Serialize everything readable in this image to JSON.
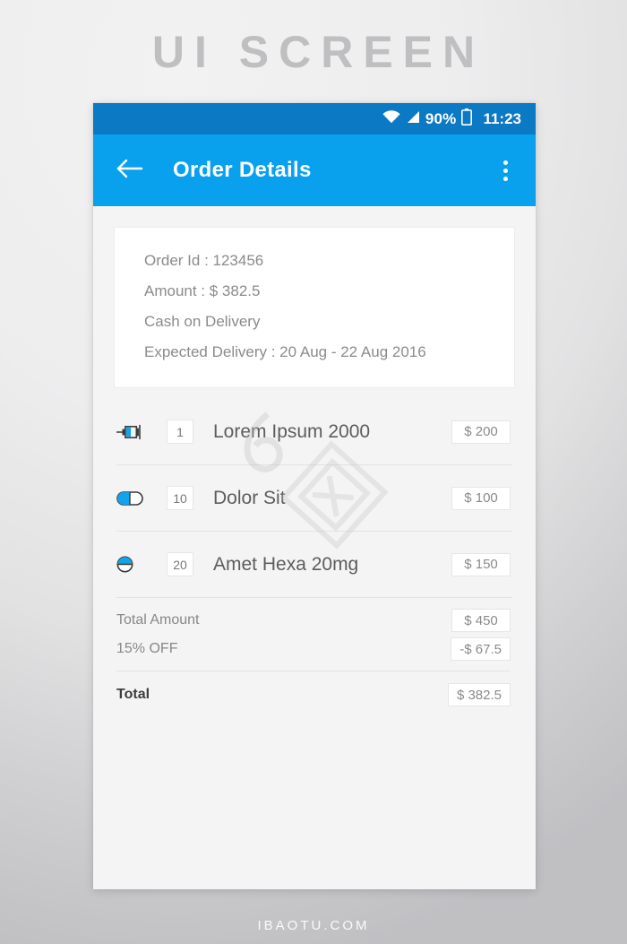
{
  "page": {
    "title": "UI SCREEN",
    "footer": "IBAOTU.COM",
    "accent_color": "#09a1ee",
    "statusbar_color": "#0b79c4",
    "content_bg": "#f4f4f4"
  },
  "statusbar": {
    "wifi_icon": "wifi-icon",
    "signal_icon": "signal-icon",
    "battery_percent": "90%",
    "battery_icon": "battery-icon",
    "time": "11:23"
  },
  "appbar": {
    "back_icon": "arrow-left-icon",
    "title": "Order Details",
    "overflow_icon": "overflow-menu-icon"
  },
  "order_card": {
    "lines": [
      "Order Id : 123456",
      "Amount : $ 382.5",
      "Cash on Delivery",
      "Expected Delivery : 20 Aug - 22 Aug 2016"
    ]
  },
  "items": [
    {
      "icon": "syringe-icon",
      "quantity": "1",
      "name": "Lorem Ipsum 2000",
      "price": "$ 200"
    },
    {
      "icon": "capsule-icon",
      "quantity": "10",
      "name": "Dolor Sit",
      "price": "$ 100"
    },
    {
      "icon": "tablet-icon",
      "quantity": "20",
      "name": "Amet Hexa 20mg",
      "price": "$ 150"
    }
  ],
  "totals": {
    "subtotal_label": "Total Amount",
    "subtotal_value": "$ 450",
    "discount_label": "15% OFF",
    "discount_value": "-$ 67.5",
    "grand_label": "Total",
    "grand_value": "$ 382.5"
  }
}
